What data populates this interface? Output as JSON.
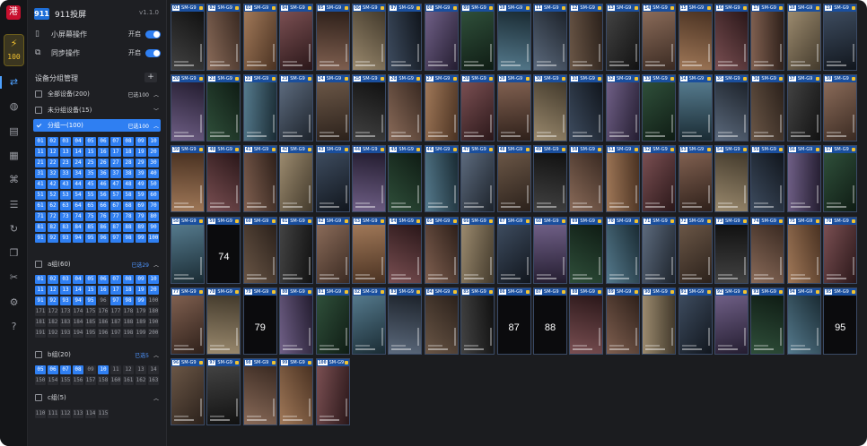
{
  "rail": {
    "logo": "港",
    "mini_icon": "⚡",
    "mini_count": "100",
    "items": [
      "mirror-icon",
      "globe-icon",
      "file-icon",
      "apk-icon",
      "command-icon",
      "list-icon",
      "refresh-icon",
      "copy-icon",
      "scissors-icon",
      "settings-icon",
      "help-icon"
    ]
  },
  "app": {
    "logo_text": "911",
    "name": "911投屏",
    "version": "v1.1.0"
  },
  "options": [
    {
      "label": "小屏幕操作",
      "state": "开启"
    },
    {
      "label": "同步操作",
      "state": "开启"
    }
  ],
  "groups_section": {
    "title": "设备分组管理",
    "add": "+"
  },
  "groups": {
    "all": {
      "label": "全部设备(200)",
      "selected": "已选100"
    },
    "ungrouped": {
      "label": "未分组设备(15)"
    },
    "g1": {
      "label": "分组一(100)",
      "selected": "已选100"
    },
    "a": {
      "label": "a组(60)",
      "selected": "已选29"
    },
    "b": {
      "label": "b组(20)",
      "selected": "已选5"
    },
    "c": {
      "label": "c组(5)"
    }
  },
  "g1_chips": [
    "01",
    "02",
    "03",
    "04",
    "05",
    "06",
    "07",
    "08",
    "09",
    "10",
    "11",
    "12",
    "13",
    "14",
    "15",
    "16",
    "17",
    "18",
    "19",
    "20",
    "21",
    "22",
    "23",
    "24",
    "25",
    "26",
    "27",
    "28",
    "29",
    "30",
    "31",
    "32",
    "33",
    "34",
    "35",
    "36",
    "37",
    "38",
    "39",
    "40",
    "41",
    "42",
    "43",
    "44",
    "45",
    "46",
    "47",
    "48",
    "49",
    "50",
    "51",
    "52",
    "53",
    "54",
    "55",
    "56",
    "57",
    "58",
    "59",
    "60",
    "61",
    "62",
    "63",
    "64",
    "65",
    "66",
    "67",
    "68",
    "69",
    "70",
    "71",
    "72",
    "73",
    "74",
    "75",
    "76",
    "77",
    "78",
    "79",
    "80",
    "81",
    "82",
    "83",
    "84",
    "85",
    "86",
    "87",
    "88",
    "89",
    "90",
    "91",
    "92",
    "93",
    "94",
    "95",
    "96",
    "97",
    "98",
    "99",
    "100"
  ],
  "a_chips": [
    {
      "t": "01",
      "on": true
    },
    {
      "t": "02",
      "on": true
    },
    {
      "t": "03",
      "on": true
    },
    {
      "t": "04",
      "on": true
    },
    {
      "t": "05",
      "on": true
    },
    {
      "t": "06",
      "on": true
    },
    {
      "t": "07",
      "on": true
    },
    {
      "t": "08",
      "on": true
    },
    {
      "t": "09",
      "on": true
    },
    {
      "t": "10",
      "on": true
    },
    {
      "t": "11",
      "on": true
    },
    {
      "t": "12",
      "on": true
    },
    {
      "t": "13",
      "on": true
    },
    {
      "t": "14",
      "on": true
    },
    {
      "t": "15",
      "on": true
    },
    {
      "t": "16",
      "on": true
    },
    {
      "t": "17",
      "on": true
    },
    {
      "t": "18",
      "on": true
    },
    {
      "t": "19",
      "on": true
    },
    {
      "t": "20",
      "on": true
    },
    {
      "t": "91",
      "on": true
    },
    {
      "t": "92",
      "on": true
    },
    {
      "t": "93",
      "on": true
    },
    {
      "t": "94",
      "on": true
    },
    {
      "t": "95",
      "on": true
    },
    {
      "t": "96",
      "on": false
    },
    {
      "t": "97",
      "on": true
    },
    {
      "t": "98",
      "on": true
    },
    {
      "t": "99",
      "on": true
    },
    {
      "t": "100",
      "on": false
    },
    {
      "t": "171",
      "on": false
    },
    {
      "t": "172",
      "on": false
    },
    {
      "t": "173",
      "on": false
    },
    {
      "t": "174",
      "on": false
    },
    {
      "t": "175",
      "on": false
    },
    {
      "t": "176",
      "on": false
    },
    {
      "t": "177",
      "on": false
    },
    {
      "t": "178",
      "on": false
    },
    {
      "t": "179",
      "on": false
    },
    {
      "t": "180",
      "on": false
    },
    {
      "t": "181",
      "on": false
    },
    {
      "t": "182",
      "on": false
    },
    {
      "t": "183",
      "on": false
    },
    {
      "t": "184",
      "on": false
    },
    {
      "t": "185",
      "on": false
    },
    {
      "t": "186",
      "on": false
    },
    {
      "t": "187",
      "on": false
    },
    {
      "t": "188",
      "on": false
    },
    {
      "t": "189",
      "on": false
    },
    {
      "t": "190",
      "on": false
    },
    {
      "t": "191",
      "on": false
    },
    {
      "t": "192",
      "on": false
    },
    {
      "t": "193",
      "on": false
    },
    {
      "t": "194",
      "on": false
    },
    {
      "t": "195",
      "on": false
    },
    {
      "t": "196",
      "on": false
    },
    {
      "t": "197",
      "on": false
    },
    {
      "t": "198",
      "on": false
    },
    {
      "t": "199",
      "on": false
    },
    {
      "t": "200",
      "on": false
    }
  ],
  "b_chips": [
    {
      "t": "05",
      "on": true
    },
    {
      "t": "06",
      "on": true
    },
    {
      "t": "07",
      "on": true
    },
    {
      "t": "08",
      "on": true
    },
    {
      "t": "09",
      "on": false
    },
    {
      "t": "10",
      "on": true
    },
    {
      "t": "11",
      "on": false
    },
    {
      "t": "12",
      "on": false
    },
    {
      "t": "13",
      "on": false
    },
    {
      "t": "14",
      "on": false
    },
    {
      "t": "150",
      "on": false
    },
    {
      "t": "154",
      "on": false
    },
    {
      "t": "155",
      "on": false
    },
    {
      "t": "156",
      "on": false
    },
    {
      "t": "157",
      "on": false
    },
    {
      "t": "158",
      "on": false
    },
    {
      "t": "160",
      "on": false
    },
    {
      "t": "161",
      "on": false
    },
    {
      "t": "162",
      "on": false
    },
    {
      "t": "163",
      "on": false
    }
  ],
  "c_chips": [
    {
      "t": "110",
      "on": false
    },
    {
      "t": "111",
      "on": false
    },
    {
      "t": "112",
      "on": false
    },
    {
      "t": "113",
      "on": false
    },
    {
      "t": "114",
      "on": false
    },
    {
      "t": "115",
      "on": false
    }
  ],
  "device_model": "SM-G9",
  "screens": {
    "columns": 19,
    "count": 100,
    "big_numbers": {
      "59": "74",
      "79": "79",
      "86": "87",
      "87": "88",
      "95": "95"
    }
  }
}
